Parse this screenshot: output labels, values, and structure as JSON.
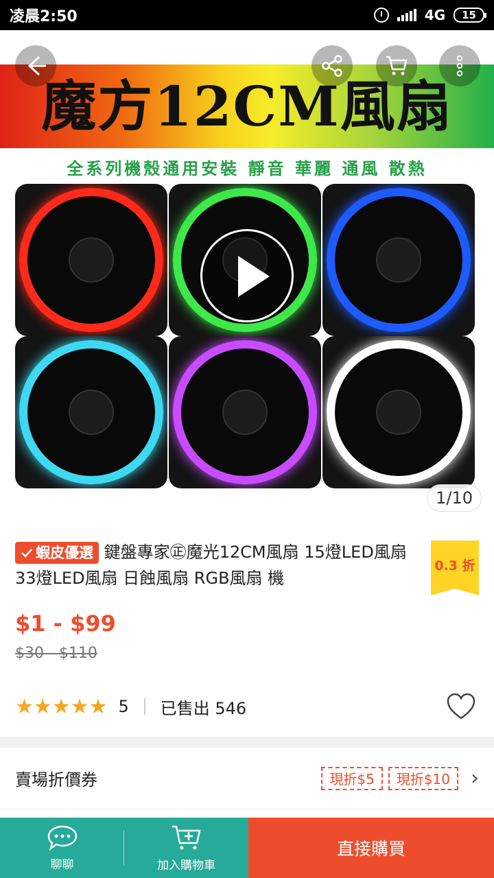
{
  "status_bar": {
    "time": "凌晨2:50",
    "network": "4G",
    "battery": "15"
  },
  "hero": {
    "banner_title": "魔方12CM風扇",
    "tagline": "全系列機殼通用安裝 靜音 華麗 通風 散熱",
    "fan_ring_colors": [
      "#ff2a1a",
      "#3ee84a",
      "#1e5bff",
      "#3fd8f2",
      "#c84cff",
      "#ffffff"
    ],
    "pager": "1/10",
    "icons": [
      "back-arrow-icon",
      "share-icon",
      "cart-icon",
      "more-vertical-icon",
      "play-icon"
    ]
  },
  "product": {
    "badge": "蝦皮優選",
    "title": "鍵盤專家㊣魔光12CM風扇 15燈LED風扇 33燈LED風扇 日蝕風扇 RGB風扇 機",
    "discount": "0.3 折",
    "price": "$1 - $99",
    "original_price": "$30 - $110",
    "rating": "5",
    "stars": "★★★★★",
    "sold": "已售出 546"
  },
  "coupons": {
    "label": "賣場折價券",
    "items": [
      "現折$5",
      "現折$10"
    ]
  },
  "bottom_bar": {
    "chat": "聊聊",
    "add_to_cart": "加入購物車",
    "buy_now": "直接購買"
  },
  "colors": {
    "brand_orange": "#ee4d2d",
    "teal": "#26aa99",
    "star": "#f5a623"
  }
}
